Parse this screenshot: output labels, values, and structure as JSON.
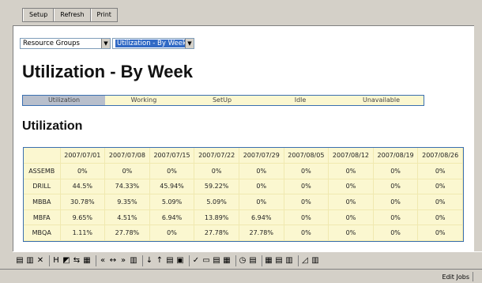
{
  "toolbar": {
    "setup": "Setup",
    "refresh": "Refresh",
    "print": "Print"
  },
  "filters": {
    "group": "Resource Groups",
    "report": "Utilization - By Week"
  },
  "page_title": "Utilization - By Week",
  "tabs": [
    "Utilization",
    "Working",
    "SetUp",
    "Idle",
    "Unavailable"
  ],
  "active_tab": "Utilization",
  "section_title": "Utilization",
  "table": {
    "columns": [
      "2007/07/01",
      "2007/07/08",
      "2007/07/15",
      "2007/07/22",
      "2007/07/29",
      "2007/08/05",
      "2007/08/12",
      "2007/08/19",
      "2007/08/26"
    ],
    "rows": [
      {
        "name": "ASSEMB",
        "values": [
          "0%",
          "0%",
          "0%",
          "0%",
          "0%",
          "0%",
          "0%",
          "0%",
          "0%"
        ]
      },
      {
        "name": "DRILL",
        "values": [
          "44.5%",
          "74.33%",
          "45.94%",
          "59.22%",
          "0%",
          "0%",
          "0%",
          "0%",
          "0%"
        ]
      },
      {
        "name": "MBBA",
        "values": [
          "30.78%",
          "9.35%",
          "5.09%",
          "5.09%",
          "0%",
          "0%",
          "0%",
          "0%",
          "0%"
        ]
      },
      {
        "name": "MBFA",
        "values": [
          "9.65%",
          "4.51%",
          "6.94%",
          "13.89%",
          "6.94%",
          "0%",
          "0%",
          "0%",
          "0%"
        ]
      },
      {
        "name": "MBQA",
        "values": [
          "1.11%",
          "27.78%",
          "0%",
          "27.78%",
          "27.78%",
          "0%",
          "0%",
          "0%",
          "0%"
        ]
      }
    ]
  },
  "statusbar": {
    "text": "Edit Jobs"
  },
  "colors": {
    "table_bg": "#fbf7d0",
    "border_blue": "#3a6fb0",
    "active_tab": "#b8bfcc",
    "selection": "#316ac5"
  }
}
